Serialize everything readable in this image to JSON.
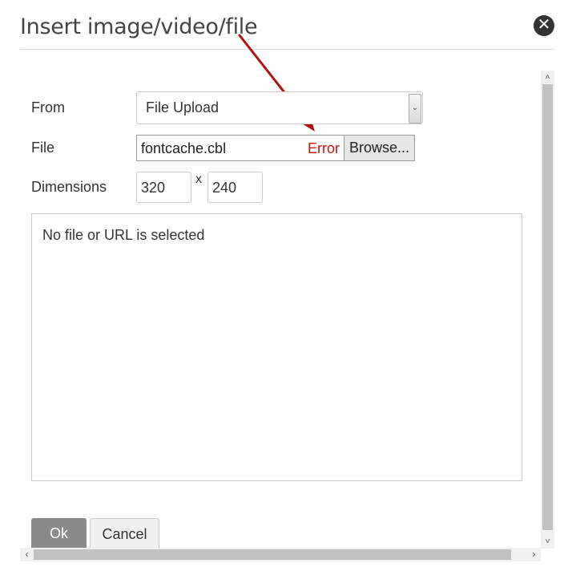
{
  "dialog": {
    "title": "Insert image/video/file",
    "close_icon": "close-icon",
    "close_glyph": "✕"
  },
  "form": {
    "from_label": "From",
    "from_value": "File Upload",
    "select_arrow_glyph": "⌄",
    "file_label": "File",
    "file_value": "fontcache.cbl",
    "file_error": "Error",
    "browse_label": "Browse...",
    "dimensions_label": "Dimensions",
    "width": "320",
    "separator": "x",
    "height": "240"
  },
  "preview": {
    "message": "No file or URL is selected"
  },
  "buttons": {
    "ok": "Ok",
    "cancel": "Cancel"
  },
  "scrollbars": {
    "up_glyph": "˄",
    "down_glyph": "˅",
    "left_glyph": "‹",
    "right_glyph": "›"
  },
  "colors": {
    "error": "#cc1111",
    "annotation_arrow": "#b01010",
    "ok_button": "#8a8a8a"
  }
}
